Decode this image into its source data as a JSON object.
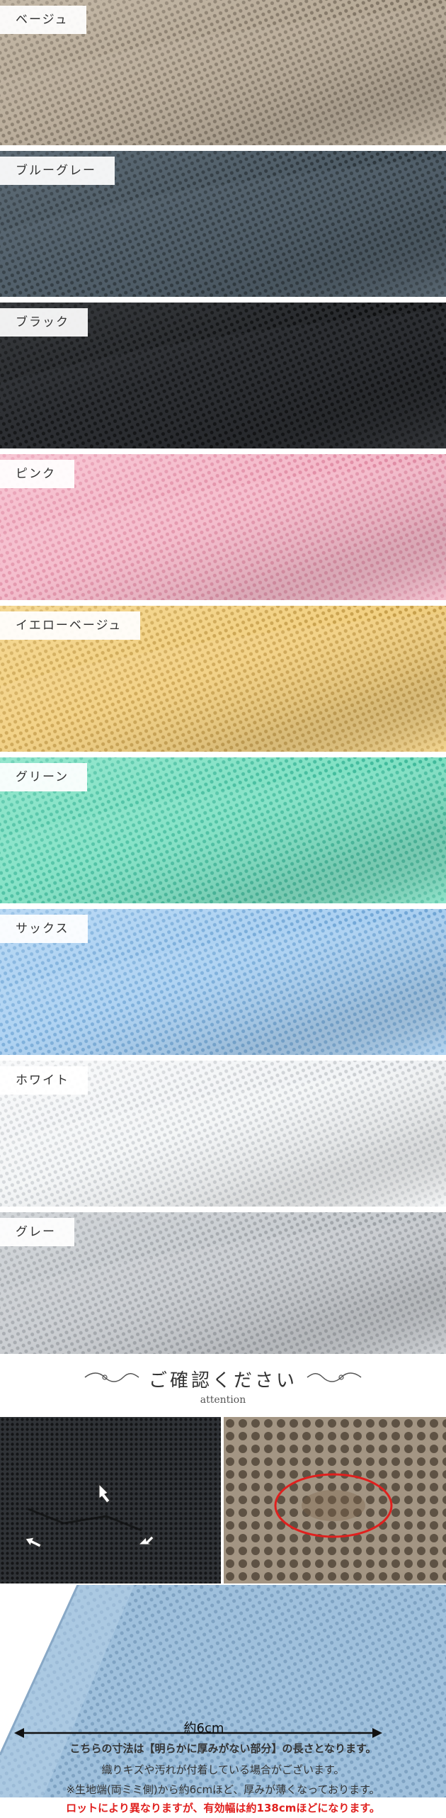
{
  "swatches": [
    {
      "label": "ベージュ",
      "base": "#b6a996",
      "dot": "#7e7262",
      "light": "#cfc4b4"
    },
    {
      "label": "ブルーグレー",
      "base": "#4c5a64",
      "dot": "#2a3339",
      "light": "#6c7a85"
    },
    {
      "label": "ブラック",
      "base": "#26282b",
      "dot": "#0b0c0d",
      "light": "#45484c"
    },
    {
      "label": "ピンク",
      "base": "#f3b7c8",
      "dot": "#e08aa3",
      "light": "#fad2dd"
    },
    {
      "label": "イエローベージュ",
      "base": "#f1cf7f",
      "dot": "#c79e48",
      "light": "#f8e0a6"
    },
    {
      "label": "グリーン",
      "base": "#7ee0c2",
      "dot": "#3cb99a",
      "light": "#a8ecd7"
    },
    {
      "label": "サックス",
      "base": "#a9cff1",
      "dot": "#6ea5d6",
      "light": "#c7e1f7"
    },
    {
      "label": "ホワイト",
      "base": "#f1f3f5",
      "dot": "#c9cdd1",
      "light": "#ffffff"
    },
    {
      "label": "グレー",
      "base": "#c7cbcf",
      "dot": "#9ba0a5",
      "light": "#dcdfe2"
    }
  ],
  "attention": {
    "title": "ご確認ください",
    "subtitle": "attention"
  },
  "measure": {
    "label": "約6cm"
  },
  "notes": {
    "line1": "こちらの寸法は【明らかに厚みがない部分】の長さとなります。",
    "line2": "織りキズや汚れが付着している場合がございます。",
    "line3": "※生地端(両ミミ側)から約6cmほど、厚みが薄くなっております。",
    "line4": "ロットにより異なりますが、有効幅は約138cmほどになります。"
  },
  "colors": {
    "accent_red": "#e0201e",
    "text": "#333333"
  }
}
